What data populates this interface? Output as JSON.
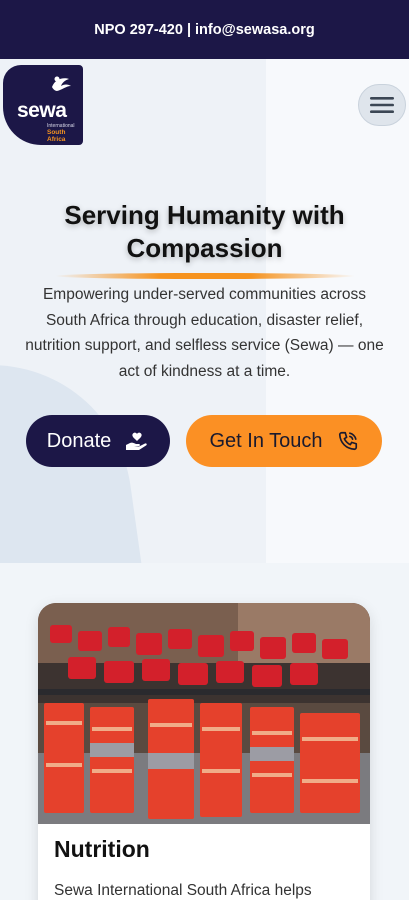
{
  "topbar": {
    "text": "NPO 297-420 | info@sewasa.org"
  },
  "logo": {
    "word": "sewa",
    "line1": "International",
    "line2": "South Africa"
  },
  "menu": {
    "icon": "hamburger-icon"
  },
  "hero": {
    "title": "Serving Humanity with Compassion",
    "description": "Empowering under-served communities across South Africa through education, disaster relief, nutrition support, and selfless service (Sewa) — one act of kindness at a time.",
    "donate_label": "Donate",
    "donate_icon": "hand-heart-icon",
    "touch_label": "Get In Touch",
    "touch_icon": "phone-icon"
  },
  "card": {
    "title": "Nutrition",
    "text": "Sewa International South Africa helps",
    "image": "food-parcels-photo"
  },
  "colors": {
    "navy": "#1c1747",
    "orange": "#fb9024",
    "background": "#eef2f7"
  }
}
